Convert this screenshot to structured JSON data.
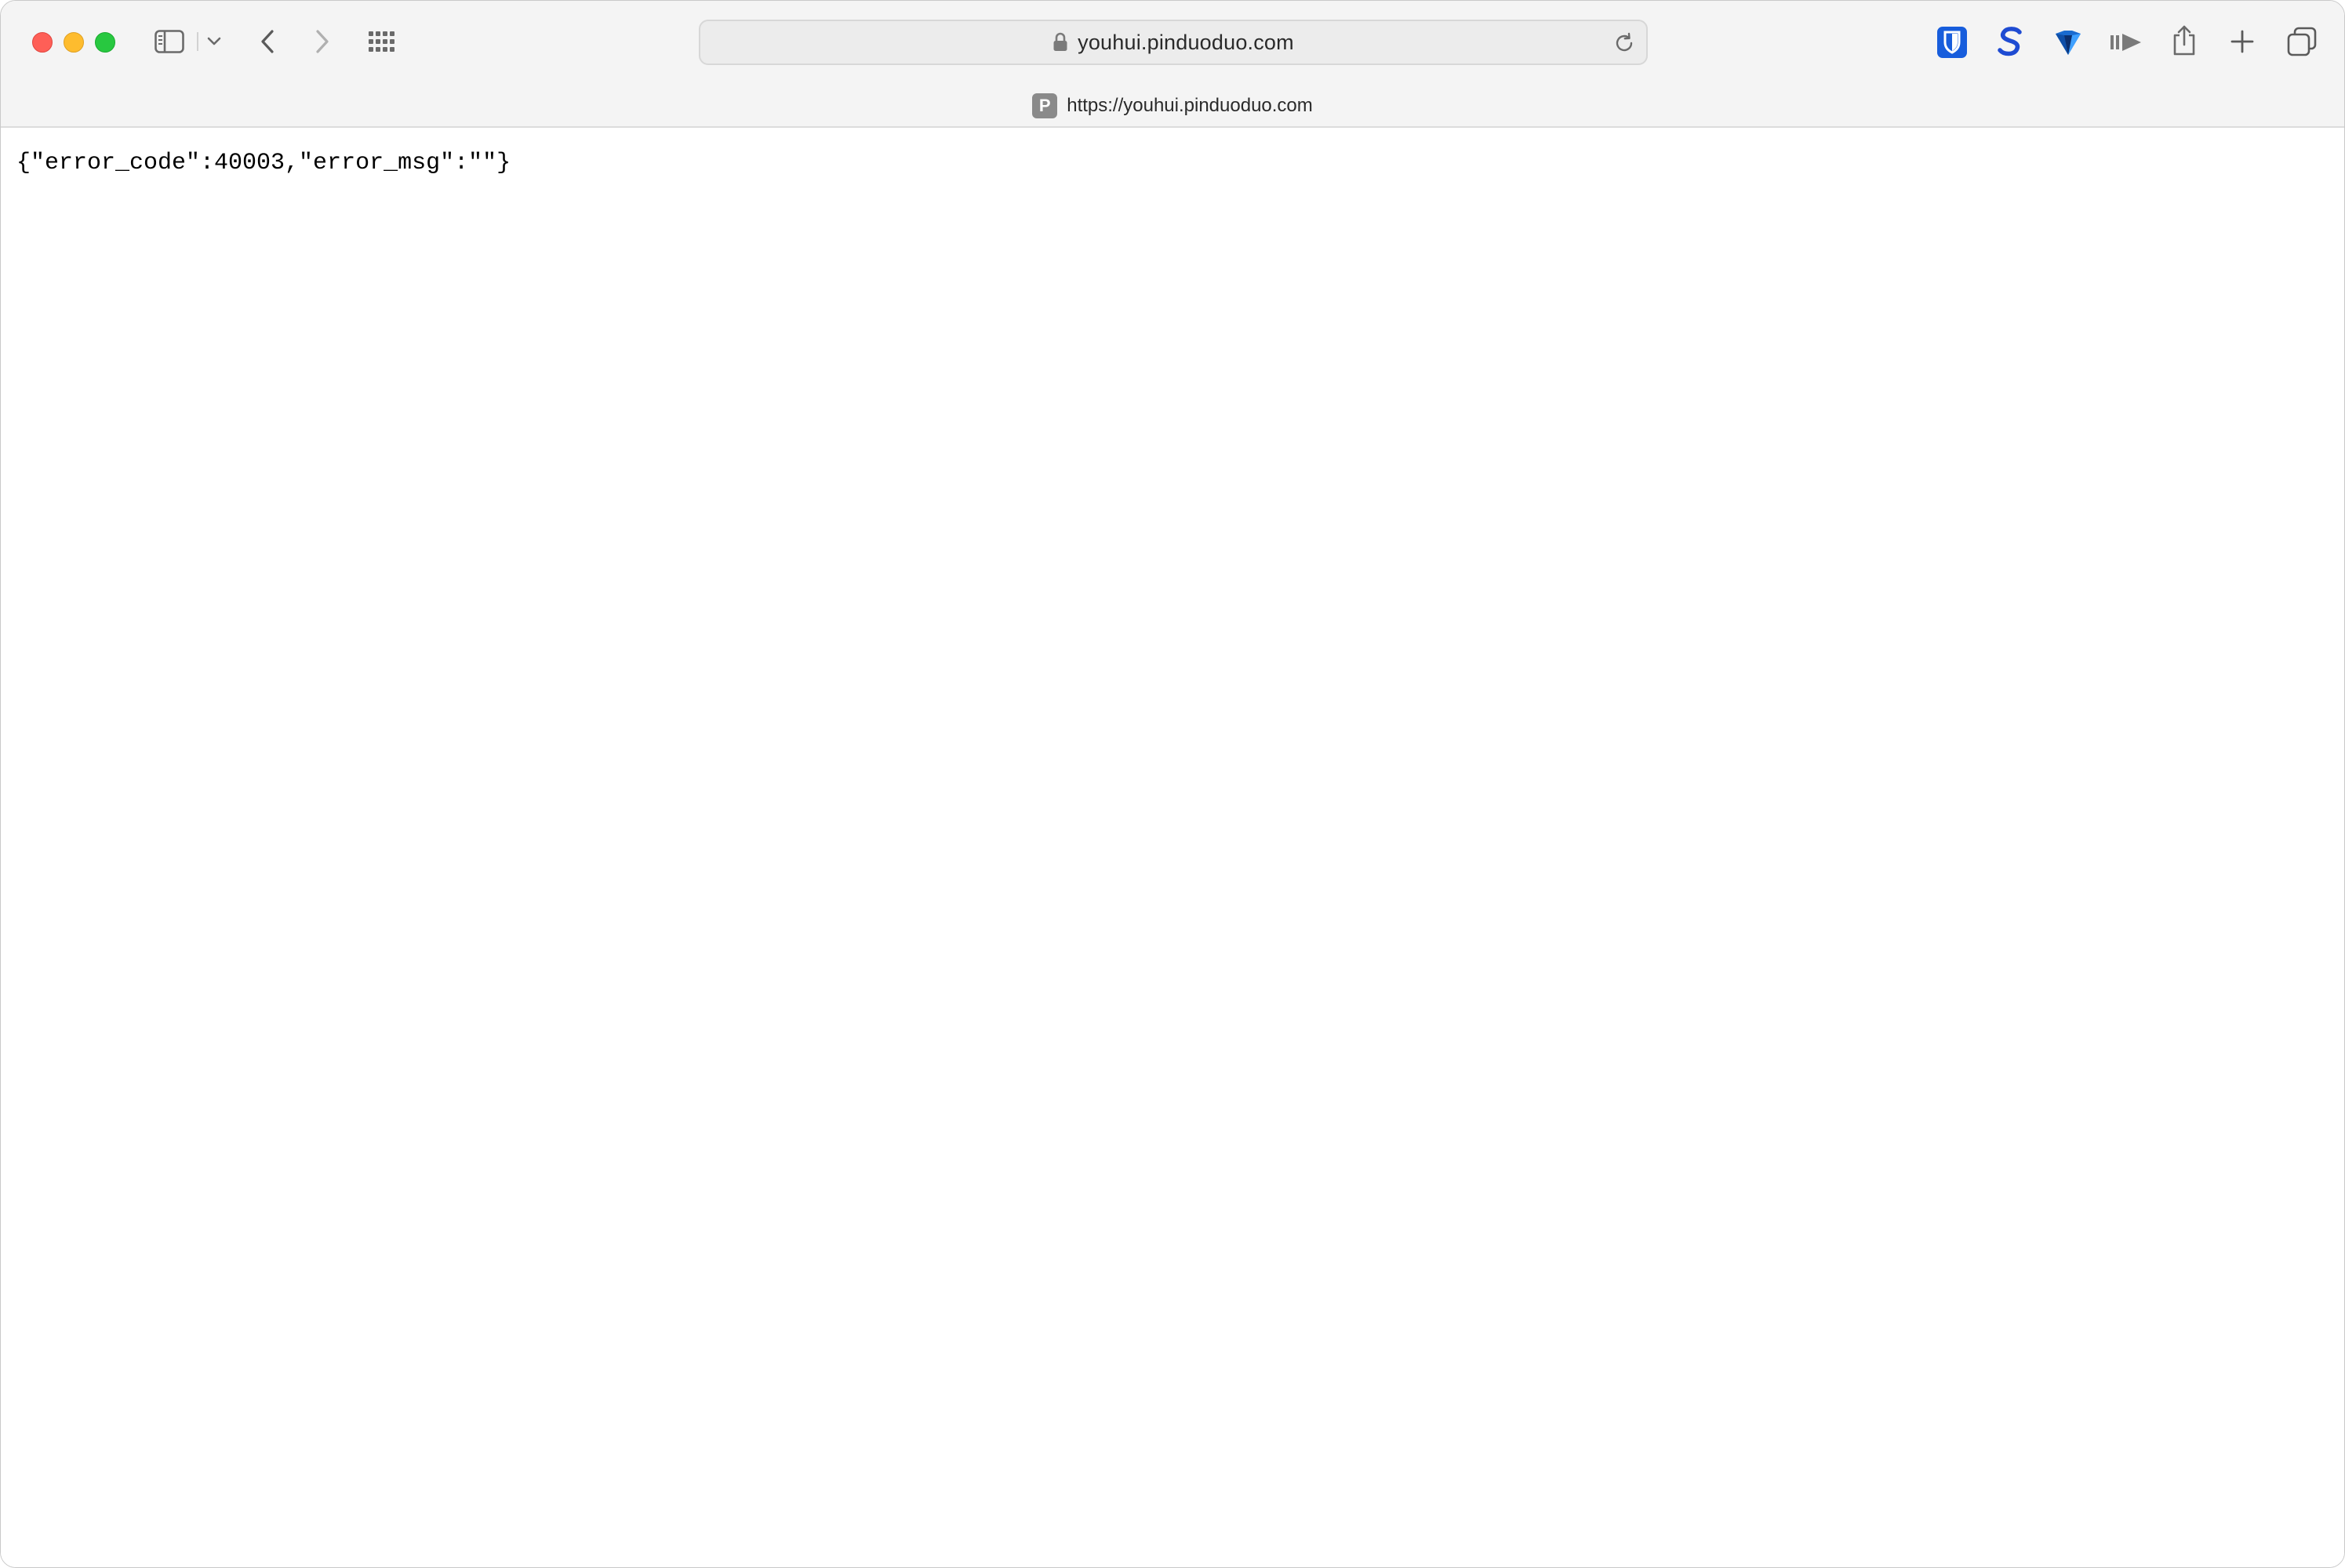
{
  "browser": {
    "address_bar": {
      "host": "youhui.pinduoduo.com",
      "secure": true
    },
    "tab": {
      "favicon_letter": "P",
      "title": "https://youhui.pinduoduo.com"
    },
    "toolbar_icons": [
      "sidebar-icon",
      "chevron-down-icon",
      "back-icon",
      "forward-icon",
      "grid-icon",
      "lock-icon",
      "reload-icon",
      "bitwarden-icon",
      "s-extension-icon",
      "diamond-extension-icon",
      "media-icon",
      "share-icon",
      "new-tab-icon",
      "tabs-overview-icon"
    ],
    "colors": {
      "close": "#fe5f57",
      "minimize": "#febc2e",
      "maximize": "#28c840",
      "bitwarden": "#175ddc",
      "s_extension": "#1e4bd2",
      "diamond_extension": "#1a6bd0"
    }
  },
  "page": {
    "body_text": "{\"error_code\":40003,\"error_msg\":\"\"}"
  }
}
